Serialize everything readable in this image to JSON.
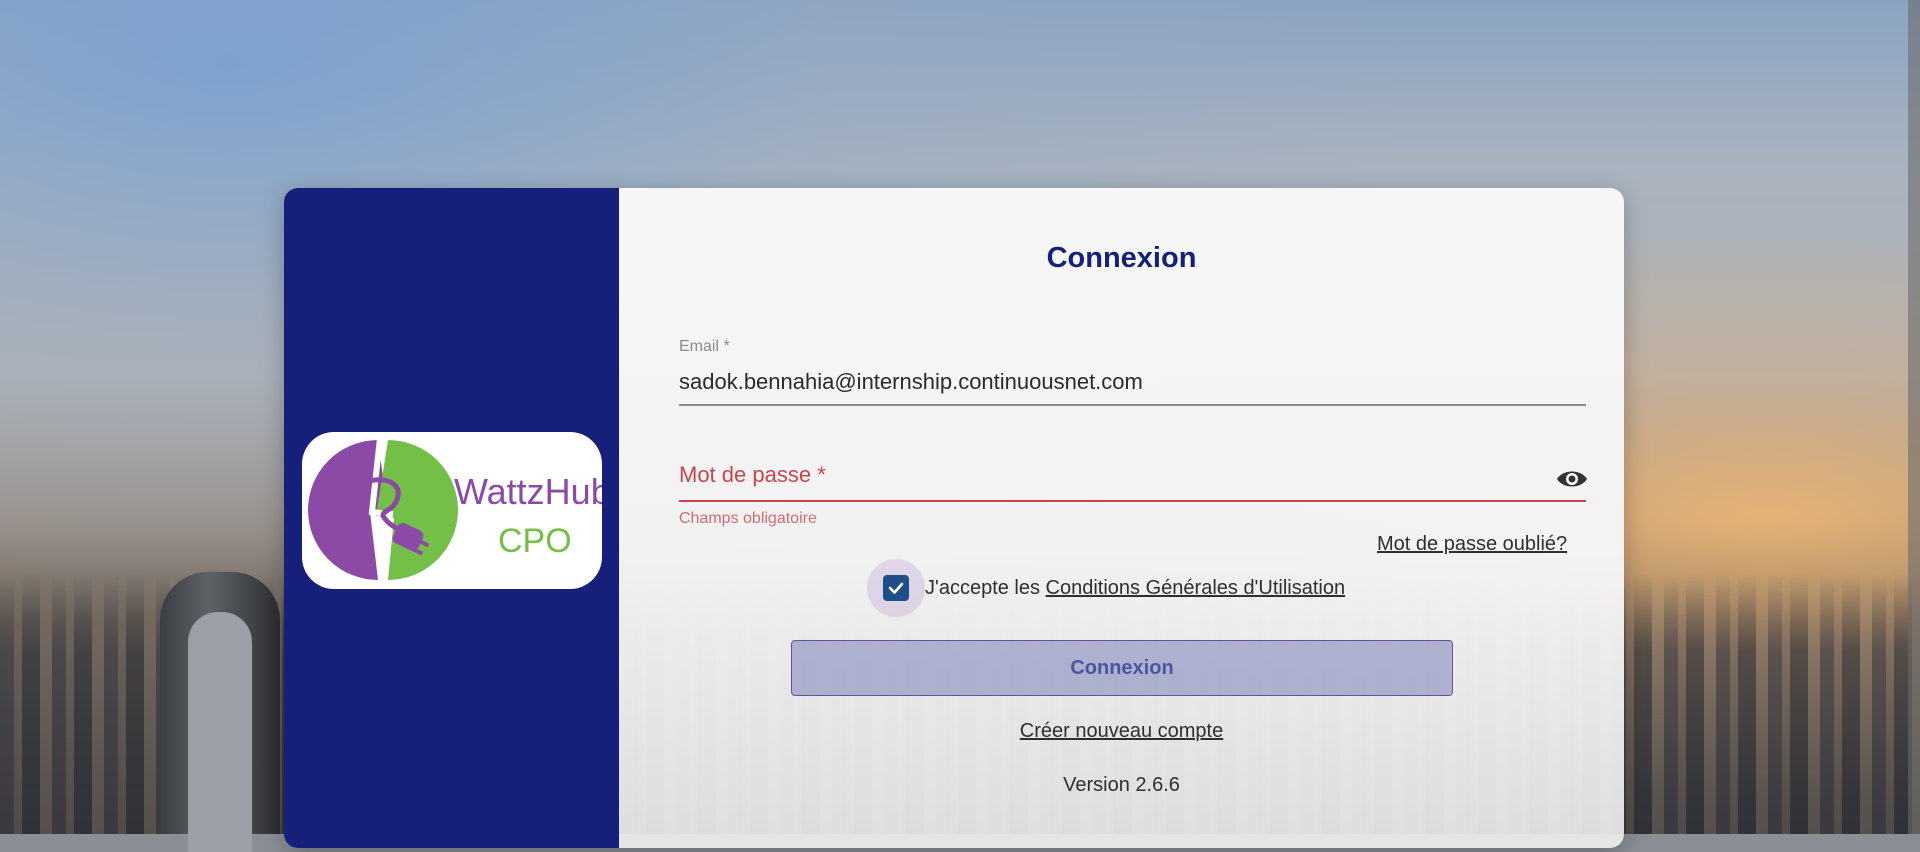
{
  "colors": {
    "brand_navy": "#16207a",
    "error": "#c8454e",
    "logo_purple": "#8b4aa6",
    "logo_green": "#74bf48",
    "checkbox": "#1f4f86"
  },
  "logo": {
    "brand_name": "WattzHub",
    "product": "CPO",
    "icon": "plug-lightning-icon"
  },
  "form": {
    "title": "Connexion",
    "email": {
      "label": "Email *",
      "value": "sadok.bennahia@internship.continuousnet.com"
    },
    "password": {
      "label": "Mot de passe *",
      "value": "",
      "error": "Champs obligatoire",
      "toggle_icon": "eye-icon"
    },
    "forgot_password": "Mot de passe oublié?",
    "terms": {
      "checked": true,
      "prefix": "J'accepte les ",
      "link": "Conditions Générales d'Utilisation"
    },
    "submit_label": "Connexion",
    "create_account": "Créer nouveau compte",
    "version": "Version 2.6.6"
  }
}
